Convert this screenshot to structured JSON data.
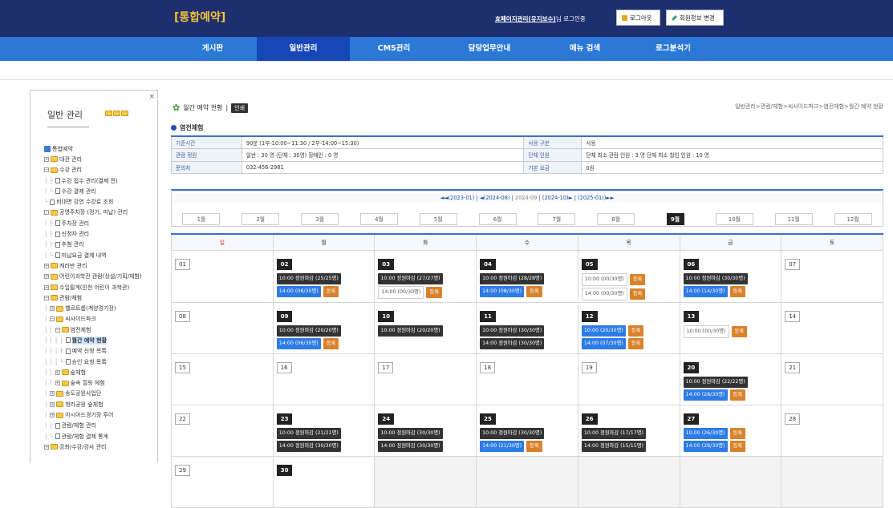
{
  "header": {
    "logo": "[통합예약]",
    "user_link": "효페이지관리(유지보수)",
    "user_suffix": "님 로그인중",
    "logout_label": "로그아웃",
    "profile_label": "회원정보 변경",
    "color_bg": "#1d2f6e",
    "color_logo": "#f4c23b"
  },
  "nav": {
    "tabs": [
      {
        "label": "게시판",
        "active": false
      },
      {
        "label": "일반관리",
        "active": true
      },
      {
        "label": "CMS관리",
        "active": false
      },
      {
        "label": "담당업무안내",
        "active": false
      },
      {
        "label": "메뉴 검색",
        "active": false
      },
      {
        "label": "로그분석기",
        "active": false
      }
    ],
    "color_bg": "#2b78d6",
    "color_active": "#1746b6"
  },
  "sidebar": {
    "close": "×",
    "title": "일반 관리",
    "tree": [
      {
        "label": "통합예약",
        "kind": "root",
        "guides": ""
      },
      {
        "label": "대관 관리",
        "kind": "folder",
        "pm": "+",
        "guides": ""
      },
      {
        "label": "수강 관리",
        "kind": "folder",
        "pm": "−",
        "guides": ""
      },
      {
        "label": "수강 접수 관리(결제 전)",
        "kind": "doc",
        "guides": "│ ├"
      },
      {
        "label": "수강 결제 관리",
        "kind": "doc",
        "guides": "│ └"
      },
      {
        "label": "비대면 강연 수강료 조회",
        "kind": "doc",
        "guides": "└"
      },
      {
        "label": "공영주차장 (정기, 미납) 관리",
        "kind": "folder",
        "pm": "−",
        "guides": ""
      },
      {
        "label": "주차장 관리",
        "kind": "doc",
        "guides": "│ ├"
      },
      {
        "label": "신청자 관리",
        "kind": "doc",
        "guides": "│ ├"
      },
      {
        "label": "추첨 관리",
        "kind": "doc",
        "guides": "│ ├"
      },
      {
        "label": "미납요금 결제 내역",
        "kind": "doc",
        "guides": "│ └"
      },
      {
        "label": "캐러반 관리",
        "kind": "folder",
        "pm": "+",
        "guides": ""
      },
      {
        "label": "어린이과학관 관람(상설/기획/체험)",
        "kind": "folder",
        "pm": "+",
        "guides": ""
      },
      {
        "label": "수입필계(인천 어린이 과학관)",
        "kind": "folder",
        "pm": "+",
        "guides": ""
      },
      {
        "label": "관람/체험",
        "kind": "folder",
        "pm": "−",
        "guides": ""
      },
      {
        "label": "벨르트롬(계양경기장)",
        "kind": "folder",
        "pm": "+",
        "guides": "│"
      },
      {
        "label": "씨사이드파크",
        "kind": "folder",
        "pm": "−",
        "guides": "│"
      },
      {
        "label": "염전체험",
        "kind": "folder",
        "pm": "−",
        "guides": "│ │"
      },
      {
        "label": "월간 예약 현황",
        "kind": "doc",
        "guides": "│ │ │ ├",
        "selected": true
      },
      {
        "label": "예약 신청 목록",
        "kind": "doc",
        "guides": "│ │ │ ├"
      },
      {
        "label": "승인 요청 목록",
        "kind": "doc",
        "guides": "│ │ │ └"
      },
      {
        "label": "숲체험",
        "kind": "folder",
        "pm": "+",
        "guides": "│ │"
      },
      {
        "label": "숲속 힐링 체험",
        "kind": "folder",
        "pm": "+",
        "guides": "│ │"
      },
      {
        "label": "송도공원사업단",
        "kind": "folder",
        "pm": "+",
        "guides": "│"
      },
      {
        "label": "청라공원 숲체험",
        "kind": "folder",
        "pm": "+",
        "guides": "│"
      },
      {
        "label": "아시아드경기장 투어",
        "kind": "folder",
        "pm": "+",
        "guides": "│"
      },
      {
        "label": "관람/체험 관리",
        "kind": "doc",
        "guides": "│ ├"
      },
      {
        "label": "관람/체험 결제 통계",
        "kind": "doc",
        "guides": "│ └"
      },
      {
        "label": "강좌/수강/강사 관리",
        "kind": "folder",
        "pm": "+",
        "guides": ""
      }
    ]
  },
  "main": {
    "page_title": "월간 예약 현황",
    "print_label": "인쇄",
    "breadcrumb": "일반관리>관람/체험>씨사이드파크>염전체험>월간 예약 현황",
    "section_title": "염전체험",
    "info": [
      [
        {
          "h": "기준시간"
        },
        {
          "v": "90분 (1부-10:00~11:30 / 2부-14:00~15:30)"
        },
        {
          "h": "사용 구분"
        },
        {
          "v": "사용"
        }
      ],
      [
        {
          "h": "관람 정원"
        },
        {
          "v": "일반 : 30 명 (단체 : 30명)      장애인 : 0 명"
        },
        {
          "h": "단체 인원"
        },
        {
          "v": "단체 최소 관람 인원 : 3 명      단체 최소 할인 인원 : 10 명"
        }
      ],
      [
        {
          "h": "문의처"
        },
        {
          "v": "032-456-2981"
        },
        {
          "h": "기본 요금"
        },
        {
          "v": "0원"
        }
      ]
    ],
    "year_nav": {
      "prev_year": "◄◄(2023-01)",
      "prev_month": "◄(2024-08)",
      "current": "2024-09",
      "next_month": "(2024-10)►",
      "next_year": "(2025-01))►►",
      "sep": " | "
    },
    "months": [
      "1월",
      "2월",
      "3월",
      "4월",
      "5월",
      "6월",
      "7월",
      "8월",
      "9월",
      "10월",
      "11월",
      "12월"
    ],
    "active_month": 8,
    "weekdays": [
      "일",
      "월",
      "화",
      "수",
      "목",
      "금",
      "토"
    ],
    "weeks": [
      [
        {
          "d": "01"
        },
        {
          "d": "02",
          "active": true,
          "slots": [
            {
              "t": "10:00 정원마감 (25/25명)",
              "s": "closed"
            },
            {
              "t": "14:00 (06/30명)",
              "s": "blue",
              "reg": true
            }
          ]
        },
        {
          "d": "03",
          "active": true,
          "slots": [
            {
              "t": "10:00 정원마감 (27/27명)",
              "s": "closed"
            },
            {
              "t": "14:00 (00/30명)",
              "s": "open",
              "reg": true
            }
          ]
        },
        {
          "d": "04",
          "active": true,
          "slots": [
            {
              "t": "10:00 정원마감 (28/28명)",
              "s": "closed"
            },
            {
              "t": "14:00 (08/30명)",
              "s": "blue",
              "reg": true
            }
          ]
        },
        {
          "d": "05",
          "active": true,
          "slots": [
            {
              "t": "10:00 (00/30명)",
              "s": "open",
              "reg": true
            },
            {
              "t": "14:00 (00/30명)",
              "s": "open",
              "reg": true
            }
          ]
        },
        {
          "d": "06",
          "active": true,
          "slots": [
            {
              "t": "10:00 정원마감 (30/30명)",
              "s": "closed"
            },
            {
              "t": "14:00 (14/30명)",
              "s": "blue",
              "reg": true
            }
          ]
        },
        {
          "d": "07"
        }
      ],
      [
        {
          "d": "08"
        },
        {
          "d": "09",
          "active": true,
          "slots": [
            {
              "t": "10:00 정원마감 (20/20명)",
              "s": "closed"
            },
            {
              "t": "14:00 (06/30명)",
              "s": "blue",
              "reg": true
            }
          ]
        },
        {
          "d": "10",
          "active": true,
          "slots": [
            {
              "t": "10:00 정원마감 (20/20명)",
              "s": "closed"
            }
          ]
        },
        {
          "d": "11",
          "active": true,
          "slots": [
            {
              "t": "10:00 정원마감 (30/30명)",
              "s": "closed"
            },
            {
              "t": "14:00 정원마감 (30/30명)",
              "s": "closed"
            }
          ]
        },
        {
          "d": "12",
          "active": true,
          "slots": [
            {
              "t": "10:00 (20/30명)",
              "s": "blue",
              "reg": true
            },
            {
              "t": "14:00 (07/30명)",
              "s": "blue",
              "reg": true
            }
          ]
        },
        {
          "d": "13",
          "active": true,
          "slots": [
            {
              "t": "10:00 (00/30명)",
              "s": "open",
              "reg": true
            }
          ]
        },
        {
          "d": "14"
        }
      ],
      [
        {
          "d": "15"
        },
        {
          "d": "16"
        },
        {
          "d": "17"
        },
        {
          "d": "18"
        },
        {
          "d": "19"
        },
        {
          "d": "20",
          "active": true,
          "slots": [
            {
              "t": "10:00 정원마감 (22/22명)",
              "s": "closed"
            },
            {
              "t": "14:00 (28/30명)",
              "s": "blue",
              "reg": true
            }
          ]
        },
        {
          "d": "21"
        }
      ],
      [
        {
          "d": "22"
        },
        {
          "d": "23",
          "active": true,
          "slots": [
            {
              "t": "10:00 정원마감 (21/21명)",
              "s": "closed"
            },
            {
              "t": "14:00 정원마감 (30/30명)",
              "s": "closed"
            }
          ]
        },
        {
          "d": "24",
          "active": true,
          "slots": [
            {
              "t": "10:00 정원마감 (30/30명)",
              "s": "closed"
            },
            {
              "t": "14:00 정원마감 (30/30명)",
              "s": "closed"
            }
          ]
        },
        {
          "d": "25",
          "active": true,
          "slots": [
            {
              "t": "10:00 정원마감 (30/30명)",
              "s": "closed"
            },
            {
              "t": "14:00 (21/30명)",
              "s": "blue",
              "reg": true
            }
          ]
        },
        {
          "d": "26",
          "active": true,
          "slots": [
            {
              "t": "10:00 정원마감 (17/17명)",
              "s": "closed"
            },
            {
              "t": "14:00 정원마감 (15/15명)",
              "s": "closed"
            }
          ]
        },
        {
          "d": "27",
          "active": true,
          "slots": [
            {
              "t": "10:00 (26/30명)",
              "s": "blue",
              "reg": true
            },
            {
              "t": "14:00 (28/30명)",
              "s": "blue",
              "reg": true
            }
          ]
        },
        {
          "d": "28"
        }
      ],
      [
        {
          "d": "29"
        },
        {
          "d": "30",
          "active": true
        },
        {
          "blank": true
        },
        {
          "blank": true
        },
        {
          "blank": true
        },
        {
          "blank": true
        },
        {
          "blank": true
        }
      ]
    ],
    "register_label": "등록",
    "color_accent": "#3a6fc9",
    "color_register": "#d9822b",
    "color_slot_blue": "#2d7be6"
  }
}
